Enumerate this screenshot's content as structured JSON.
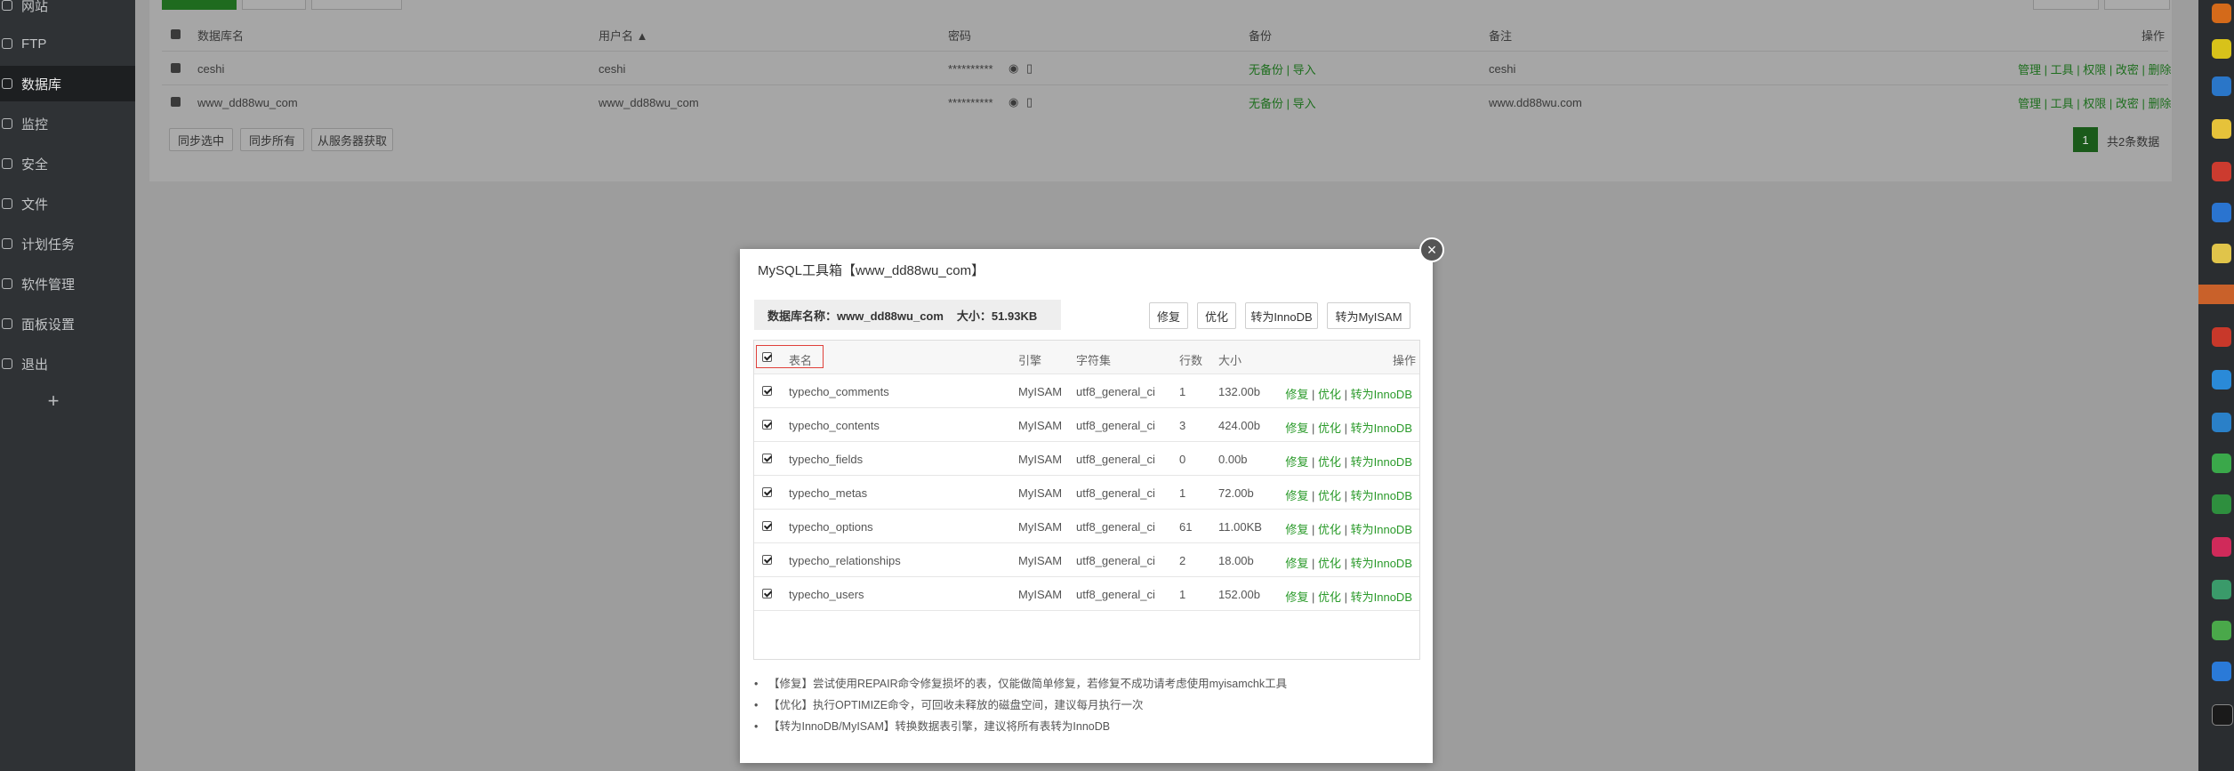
{
  "sidebar": {
    "items": [
      {
        "label": "网站",
        "active": false
      },
      {
        "label": "FTP",
        "active": false
      },
      {
        "label": "数据库",
        "active": true
      },
      {
        "label": "监控",
        "active": false
      },
      {
        "label": "安全",
        "active": false
      },
      {
        "label": "文件",
        "active": false
      },
      {
        "label": "计划任务",
        "active": false
      },
      {
        "label": "软件管理",
        "active": false
      },
      {
        "label": "面板设置",
        "active": false
      },
      {
        "label": "退出",
        "active": false
      }
    ],
    "add_label": "+"
  },
  "db_table": {
    "headers": {
      "name": "数据库名",
      "user": "用户名 ▲",
      "password": "密码",
      "backup": "备份",
      "remark": "备注",
      "ops": "操作"
    },
    "rows": [
      {
        "name": "ceshi",
        "user": "ceshi",
        "password": "**********",
        "backup": "无备份",
        "import": "导入",
        "remark": "ceshi",
        "ops": [
          "管理",
          "工具",
          "权限",
          "改密",
          "删除"
        ]
      },
      {
        "name": "www_dd88wu_com",
        "user": "www_dd88wu_com",
        "password": "**********",
        "backup": "无备份",
        "import": "导入",
        "remark": "www.dd88wu.com",
        "ops": [
          "管理",
          "工具",
          "权限",
          "改密",
          "删除"
        ]
      }
    ],
    "buttons": {
      "sync_selected": "同步选中",
      "sync_all": "同步所有",
      "fetch_from_server": "从服务器获取"
    },
    "pagination": {
      "current": "1",
      "total_text": "共2条数据"
    }
  },
  "dialog": {
    "title": "MySQL工具箱【www_dd88wu_com】",
    "close": "×",
    "db_name_label": "数据库名称：www_dd88wu_com",
    "size_label": "大小：51.93KB",
    "buttons": {
      "repair": "修复",
      "optimize": "优化",
      "to_innodb": "转为InnoDB",
      "to_myisam": "转为MyISAM"
    },
    "table": {
      "headers": {
        "name": "表名",
        "engine": "引擎",
        "charset": "字符集",
        "rows": "行数",
        "size": "大小",
        "ops": "操作"
      },
      "rows": [
        {
          "name": "typecho_comments",
          "engine": "MyISAM",
          "charset": "utf8_general_ci",
          "rows": "1",
          "size": "132.00b"
        },
        {
          "name": "typecho_contents",
          "engine": "MyISAM",
          "charset": "utf8_general_ci",
          "rows": "3",
          "size": "424.00b"
        },
        {
          "name": "typecho_fields",
          "engine": "MyISAM",
          "charset": "utf8_general_ci",
          "rows": "0",
          "size": "0.00b"
        },
        {
          "name": "typecho_metas",
          "engine": "MyISAM",
          "charset": "utf8_general_ci",
          "rows": "1",
          "size": "72.00b"
        },
        {
          "name": "typecho_options",
          "engine": "MyISAM",
          "charset": "utf8_general_ci",
          "rows": "61",
          "size": "11.00KB"
        },
        {
          "name": "typecho_relationships",
          "engine": "MyISAM",
          "charset": "utf8_general_ci",
          "rows": "2",
          "size": "18.00b"
        },
        {
          "name": "typecho_users",
          "engine": "MyISAM",
          "charset": "utf8_general_ci",
          "rows": "1",
          "size": "152.00b"
        }
      ],
      "row_ops": {
        "repair": "修复",
        "optimize": "优化",
        "to_innodb": "转为InnoDB"
      }
    },
    "notes": [
      "【修复】尝试使用REPAIR命令修复损坏的表，仅能做简单修复，若修复不成功请考虑使用myisamchk工具",
      "【优化】执行OPTIMIZE命令，可回收未释放的磁盘空间，建议每月执行一次",
      "【转为InnoDB/MyISAM】转换数据表引擎，建议将所有表转为InnoDB"
    ]
  },
  "colors": {
    "accent_green": "#20a53a",
    "sidebar_bg": "#2f3235",
    "overlay_bg": "#9c9c9c"
  }
}
